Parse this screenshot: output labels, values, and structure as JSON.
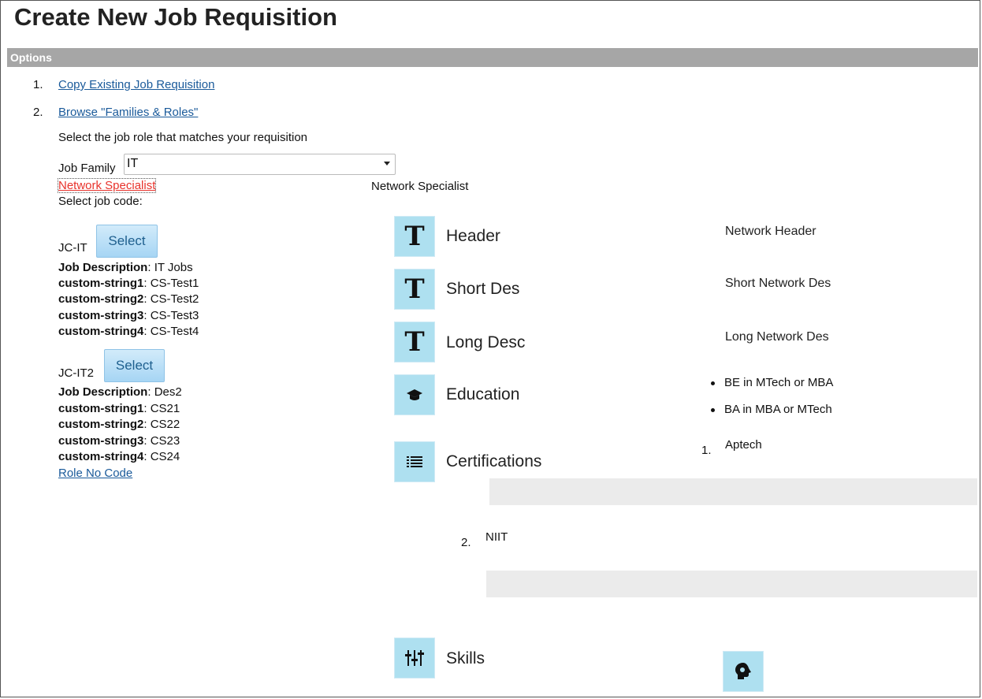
{
  "page": {
    "title": "Create New Job Requisition"
  },
  "options_bar": {
    "label": "Options"
  },
  "options": [
    {
      "number": "1.",
      "label": "Copy Existing Job Requisition"
    },
    {
      "number": "2.",
      "label": "Browse \"Families & Roles\""
    }
  ],
  "instruction": "Select the job role that matches your requisition",
  "job_family": {
    "label": "Job Family",
    "selected": "IT"
  },
  "role_link": "Network Specialist",
  "role_title": "Network Specialist",
  "select_job_code_label": "Select job code:",
  "job_codes": [
    {
      "code": "JC-IT",
      "button": "Select",
      "fields": [
        {
          "key": "Job Description",
          "value": ": IT Jobs"
        },
        {
          "key": "custom-string1",
          "value": ": CS-Test1"
        },
        {
          "key": "custom-string2",
          "value": ": CS-Test2"
        },
        {
          "key": "custom-string3",
          "value": ": CS-Test3"
        },
        {
          "key": "custom-string4",
          "value": ": CS-Test4"
        }
      ]
    },
    {
      "code": "JC-IT2",
      "button": "Select",
      "fields": [
        {
          "key": "Job Description",
          "value": ": Des2"
        },
        {
          "key": "custom-string1",
          "value": ": CS21"
        },
        {
          "key": "custom-string2",
          "value": ": CS22"
        },
        {
          "key": "custom-string3",
          "value": ": CS23"
        },
        {
          "key": "custom-string4",
          "value": ": CS24"
        }
      ]
    }
  ],
  "role_no_code_link": "Role No Code",
  "sections": {
    "header": {
      "label": "Header",
      "value": "Network Header",
      "icon": "text-t-icon"
    },
    "short_desc": {
      "label": "Short Des",
      "value": "Short Network Des",
      "icon": "text-t-icon"
    },
    "long_desc": {
      "label": "Long Desc",
      "value": "Long Network Des",
      "icon": "text-t-icon"
    },
    "education": {
      "label": "Education",
      "items": [
        "BE in MTech or MBA",
        "BA in MBA or MTech"
      ],
      "icon": "graduation-cap-icon"
    },
    "certifications": {
      "label": "Certifications",
      "items": [
        {
          "number": "1.",
          "name": "Aptech"
        },
        {
          "number": "2.",
          "name": "NIIT"
        }
      ],
      "icon": "list-icon"
    },
    "skills": {
      "label": "Skills",
      "icon": "sliders-icon"
    }
  },
  "colors": {
    "options_bar": "#a6a6a6",
    "icon_bg": "#aee0f0",
    "link": "#1a5a9a",
    "role_link": "#e8322b",
    "button_bg": "#b8defa"
  }
}
